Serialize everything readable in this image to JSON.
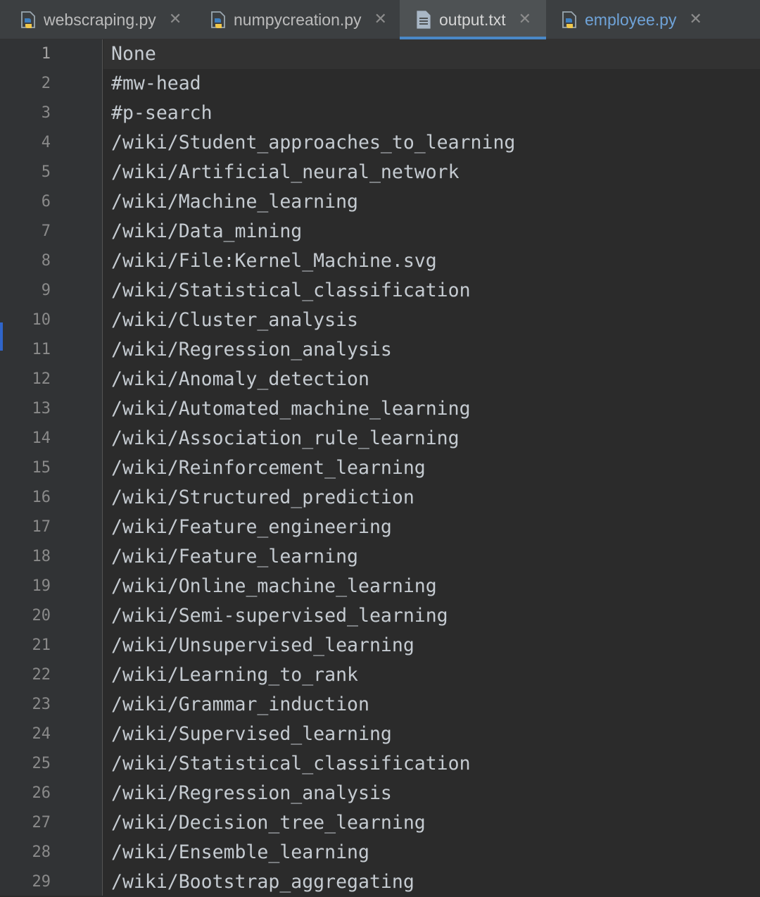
{
  "tabs": [
    {
      "label": "webscraping.py",
      "icon": "python-file-icon",
      "active": false
    },
    {
      "label": "numpycreation.py",
      "icon": "python-file-icon",
      "active": false
    },
    {
      "label": "output.txt",
      "icon": "text-file-icon",
      "active": true
    },
    {
      "label": "employee.py",
      "icon": "python-file-icon",
      "active": false,
      "color": "#6fa3d8"
    }
  ],
  "close_glyph": "✕",
  "editor": {
    "lines": [
      {
        "num": "1",
        "text": "None"
      },
      {
        "num": "2",
        "text": "#mw-head"
      },
      {
        "num": "3",
        "text": "#p-search"
      },
      {
        "num": "4",
        "text": "/wiki/Student_approaches_to_learning"
      },
      {
        "num": "5",
        "text": "/wiki/Artificial_neural_network"
      },
      {
        "num": "6",
        "text": "/wiki/Machine_learning"
      },
      {
        "num": "7",
        "text": "/wiki/Data_mining"
      },
      {
        "num": "8",
        "text": "/wiki/File:Kernel_Machine.svg"
      },
      {
        "num": "9",
        "text": "/wiki/Statistical_classification"
      },
      {
        "num": "10",
        "text": "/wiki/Cluster_analysis"
      },
      {
        "num": "11",
        "text": "/wiki/Regression_analysis"
      },
      {
        "num": "12",
        "text": "/wiki/Anomaly_detection"
      },
      {
        "num": "13",
        "text": "/wiki/Automated_machine_learning"
      },
      {
        "num": "14",
        "text": "/wiki/Association_rule_learning"
      },
      {
        "num": "15",
        "text": "/wiki/Reinforcement_learning"
      },
      {
        "num": "16",
        "text": "/wiki/Structured_prediction"
      },
      {
        "num": "17",
        "text": "/wiki/Feature_engineering"
      },
      {
        "num": "18",
        "text": "/wiki/Feature_learning"
      },
      {
        "num": "19",
        "text": "/wiki/Online_machine_learning"
      },
      {
        "num": "20",
        "text": "/wiki/Semi-supervised_learning"
      },
      {
        "num": "21",
        "text": "/wiki/Unsupervised_learning"
      },
      {
        "num": "22",
        "text": "/wiki/Learning_to_rank"
      },
      {
        "num": "23",
        "text": "/wiki/Grammar_induction"
      },
      {
        "num": "24",
        "text": "/wiki/Supervised_learning"
      },
      {
        "num": "25",
        "text": "/wiki/Statistical_classification"
      },
      {
        "num": "26",
        "text": "/wiki/Regression_analysis"
      },
      {
        "num": "27",
        "text": "/wiki/Decision_tree_learning"
      },
      {
        "num": "28",
        "text": "/wiki/Ensemble_learning"
      },
      {
        "num": "29",
        "text": "/wiki/Bootstrap_aggregating"
      }
    ]
  },
  "colors": {
    "background": "#2b2b2b",
    "gutter": "#313335",
    "tab_bar": "#3c3f41",
    "active_tab": "#4e5254",
    "active_tab_underline": "#4a88c7",
    "text": "#c5cbd1",
    "line_number": "#8a8a8a"
  }
}
